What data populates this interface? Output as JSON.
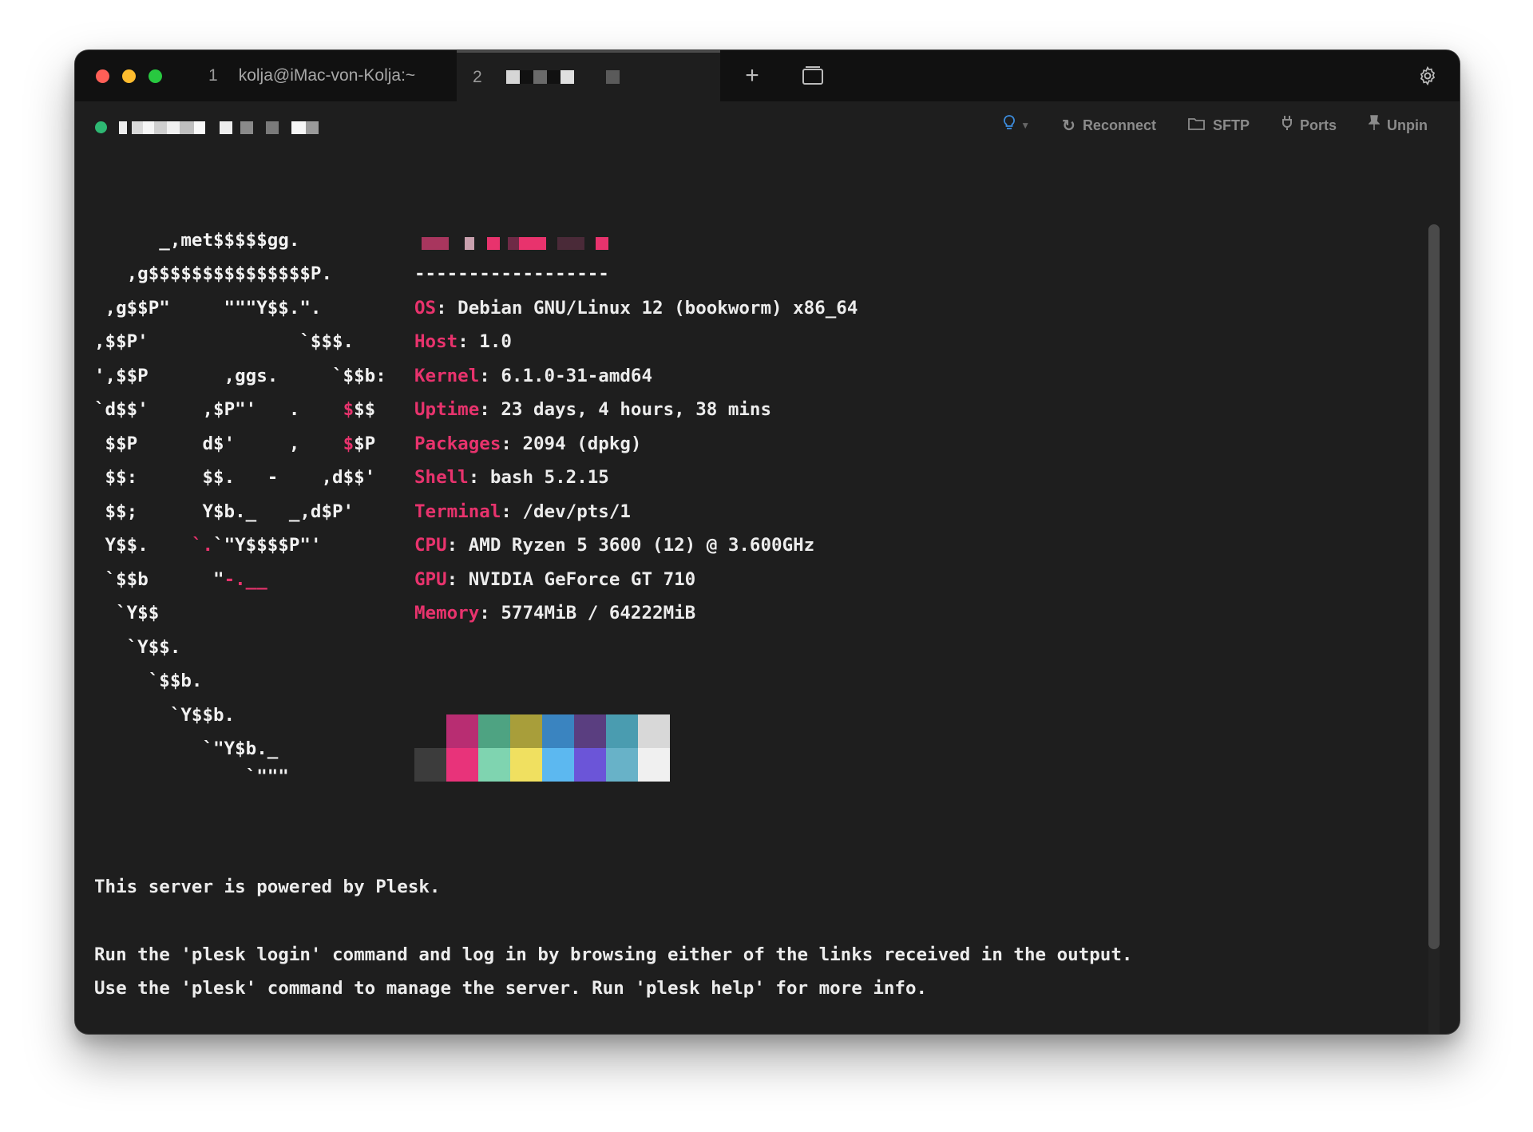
{
  "window": {
    "tabs": [
      {
        "number": "1",
        "label": "kolja@iMac-von-Kolja:~"
      },
      {
        "number": "2",
        "label": ""
      }
    ]
  },
  "toolbar": {
    "actions": [
      {
        "label": "Reconnect",
        "icon": "reconnect-icon"
      },
      {
        "label": "SFTP",
        "icon": "folder-icon"
      },
      {
        "label": "Ports",
        "icon": "plug-icon"
      },
      {
        "label": "Unpin",
        "icon": "pin-icon"
      }
    ],
    "status_color": "#2eb873"
  },
  "terminal": {
    "logo_lines": [
      "      _,met$$$$$gg.",
      "   ,g$$$$$$$$$$$$$$$P.",
      " ,g$$P\"     \"\"\"Y$$.\".",
      ",$$P'              `$$$.",
      "',$$P       ,ggs.     `$$b:",
      "`d$$'     ,$P\"'   .    $$$",
      " $$P      d$'     ,    $$P",
      " $$:      $$.   -    ,d$$'",
      " $$;      Y$b._   _,d$P'",
      " Y$$.    `.`\"Y$$$$P\"'",
      " `$$b      \"-.__",
      "  `Y$$",
      "   `Y$$.",
      "     `$$b.",
      "       `Y$$b.",
      "          `\"Y$b._",
      "              `\"\"\""
    ],
    "separator": "------------------",
    "info": [
      {
        "key": "OS",
        "value": ": Debian GNU/Linux 12 (bookworm) x86_64"
      },
      {
        "key": "Host",
        "value": ": 1.0"
      },
      {
        "key": "Kernel",
        "value": ": 6.1.0-31-amd64"
      },
      {
        "key": "Uptime",
        "value": ": 23 days, 4 hours, 38 mins"
      },
      {
        "key": "Packages",
        "value": ": 2094 (dpkg)"
      },
      {
        "key": "Shell",
        "value": ": bash 5.2.15"
      },
      {
        "key": "Terminal",
        "value": ": /dev/pts/1"
      },
      {
        "key": "CPU",
        "value": ": AMD Ryzen 5 3600 (12) @ 3.600GHz"
      },
      {
        "key": "GPU",
        "value": ": NVIDIA GeForce GT 710"
      },
      {
        "key": "Memory",
        "value": ": 5774MiB / 64222MiB"
      }
    ],
    "palette_top": [
      "#1e1e1e",
      "#b82d72",
      "#4ea382",
      "#a89e3a",
      "#3a84c0",
      "#5a3e80",
      "#4a9cb0",
      "#d8d8d8"
    ],
    "palette_bottom": [
      "#3c3c3c",
      "#e8337a",
      "#7fd4b0",
      "#f0e060",
      "#5cb8f0",
      "#6b55d8",
      "#68b2c8",
      "#f0f0f0"
    ],
    "motd": [
      "This server is powered by Plesk.",
      "",
      "Run the 'plesk login' command and log in by browsing either of the links received in the output.",
      "Use the 'plesk' command to manage the server. Run 'plesk help' for more info."
    ]
  }
}
